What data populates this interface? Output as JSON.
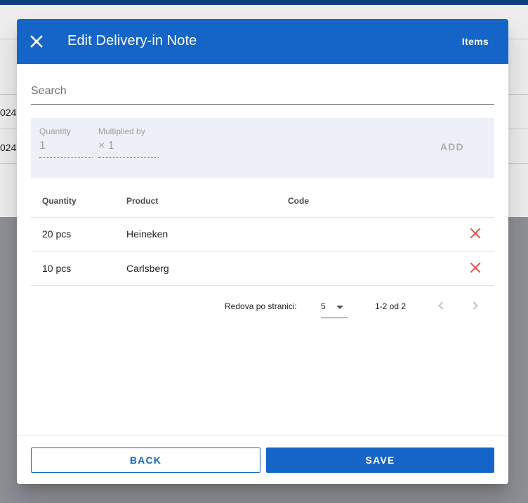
{
  "background": {
    "rows": [
      {
        "date_fragment": "024."
      },
      {
        "date_fragment": "024."
      }
    ]
  },
  "dialog": {
    "title": "Edit Delivery-in Note",
    "tab_label": "Items",
    "search": {
      "placeholder": "Search",
      "value": ""
    },
    "add_form": {
      "quantity_label": "Quantity",
      "quantity_value": "1",
      "multiplier_label": "Multiplied by",
      "multiplier_value": "× 1",
      "add_label": "ADD"
    },
    "table": {
      "headers": [
        "Quantity",
        "Product",
        "Code"
      ],
      "rows": [
        {
          "quantity": "20 pcs",
          "product": "Heineken",
          "code": ""
        },
        {
          "quantity": "10 pcs",
          "product": "Carlsberg",
          "code": ""
        }
      ]
    },
    "pagination": {
      "rows_per_page_label": "Redova po stranici:",
      "rows_per_page": "5",
      "range": "1-2 od 2"
    },
    "footer": {
      "back_label": "BACK",
      "save_label": "SAVE"
    }
  },
  "icons": {
    "close": "close-icon",
    "delete": "delete-x-icon",
    "dropdown": "caret-down-icon",
    "prev": "chevron-left-icon",
    "next": "chevron-right-icon"
  },
  "colors": {
    "primary": "#1565c8",
    "delete": "#e5534b",
    "panel_bg": "#edf0f8",
    "overlay": "#8e9096"
  }
}
